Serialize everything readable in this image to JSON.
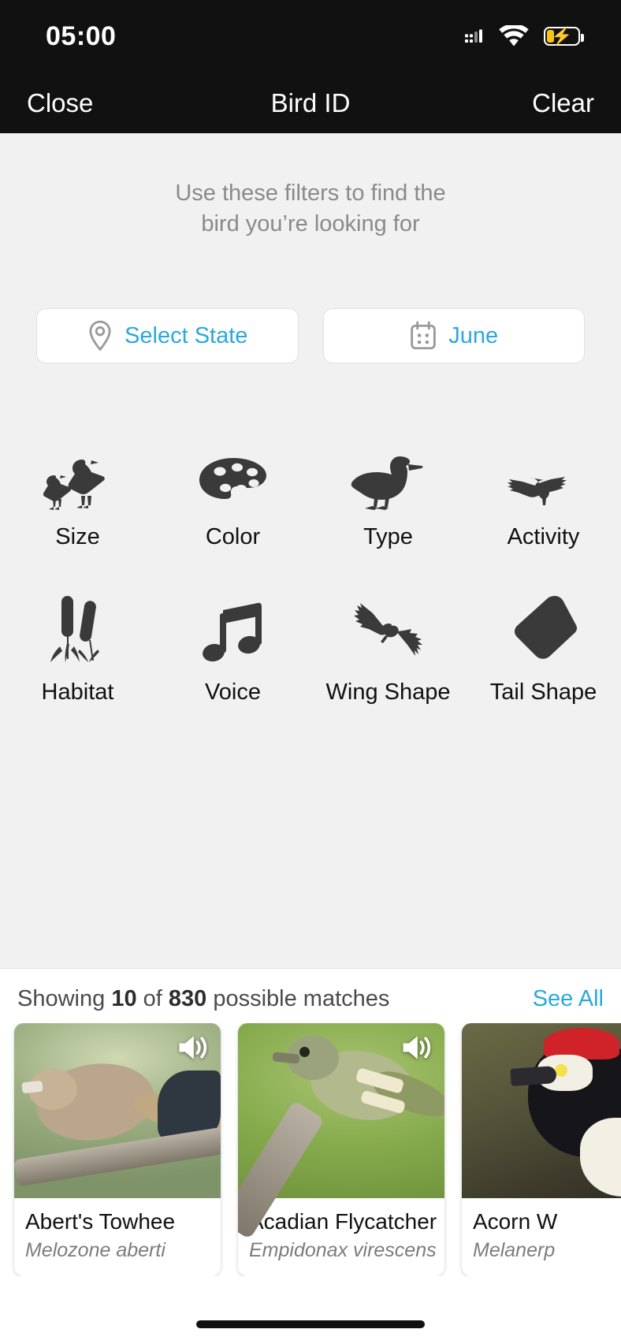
{
  "status_bar": {
    "time": "05:00",
    "signal_icon": "cellular-signal-icon",
    "wifi_icon": "wifi-icon",
    "battery_icon": "battery-charging-icon",
    "battery_charging_glyph": "⚡",
    "battery_color": "#f5c518"
  },
  "nav": {
    "close_label": "Close",
    "title": "Bird ID",
    "clear_label": "Clear"
  },
  "filters": {
    "hint_line1": "Use these filters to find the",
    "hint_line2": "bird you’re looking for",
    "accent_color": "#2aa8e0",
    "pills": [
      {
        "label": "Select State",
        "icon": "location-pin-icon"
      },
      {
        "label": "June",
        "icon": "calendar-icon"
      }
    ],
    "options": [
      {
        "label": "Size",
        "icon": "two-birds-icon"
      },
      {
        "label": "Color",
        "icon": "paint-palette-icon"
      },
      {
        "label": "Type",
        "icon": "duck-icon"
      },
      {
        "label": "Activity",
        "icon": "soaring-bird-icon"
      },
      {
        "label": "Habitat",
        "icon": "cattails-icon"
      },
      {
        "label": "Voice",
        "icon": "music-note-icon"
      },
      {
        "label": "Wing Shape",
        "icon": "flying-hawk-icon"
      },
      {
        "label": "Tail Shape",
        "icon": "tail-fan-icon"
      }
    ]
  },
  "results": {
    "showing_prefix": "Showing",
    "shown_count": "10",
    "of_label": "of",
    "total_count": "830",
    "suffix": "possible matches",
    "see_all_label": "See All",
    "audio_icon": "speaker-audio-icon",
    "cards": [
      {
        "common_name": "Abert's Towhee",
        "scientific_name": "Melozone aberti"
      },
      {
        "common_name": "Acadian Flycatcher",
        "scientific_name": "Empidonax virescens"
      },
      {
        "common_name": "Acorn W",
        "scientific_name": "Melanerp"
      }
    ]
  }
}
